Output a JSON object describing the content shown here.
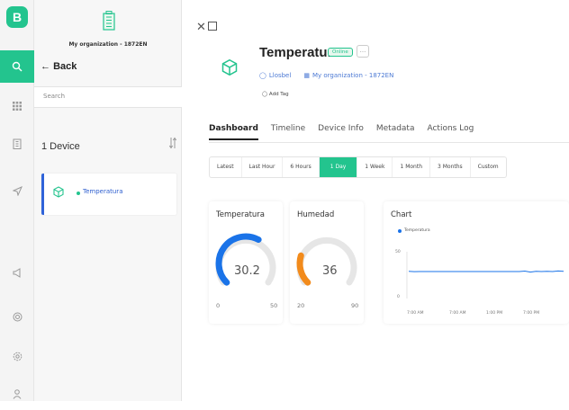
{
  "rail": {
    "logo_letter": "B",
    "icons": [
      "search-icon",
      "grid-icon",
      "building-icon",
      "send-icon",
      "megaphone-icon",
      "globe-icon",
      "settings-icon",
      "user-icon"
    ]
  },
  "panel": {
    "org_name": "My organization - 1872EN",
    "back_label": "Back",
    "search_placeholder": "Search",
    "device_count": "1 Device",
    "devices": [
      {
        "name": "Temperatura",
        "status": "online"
      }
    ]
  },
  "device": {
    "title": "Temperatura",
    "status_badge": "Online",
    "more_label": "...",
    "owner": "Llosbel",
    "organization": "My organization - 1872EN",
    "add_tag": "Add Tag"
  },
  "tabs": [
    {
      "label": "Dashboard",
      "active": true
    },
    {
      "label": "Timeline",
      "active": false
    },
    {
      "label": "Device Info",
      "active": false
    },
    {
      "label": "Metadata",
      "active": false
    },
    {
      "label": "Actions Log",
      "active": false
    }
  ],
  "time_ranges": [
    {
      "label": "Latest",
      "active": false
    },
    {
      "label": "Last Hour",
      "active": false
    },
    {
      "label": "6 Hours",
      "active": false
    },
    {
      "label": "1 Day",
      "active": true
    },
    {
      "label": "1 Week",
      "active": false
    },
    {
      "label": "1 Month",
      "active": false
    },
    {
      "label": "3 Months",
      "active": false
    },
    {
      "label": "Custom",
      "active": false
    }
  ],
  "gauges": [
    {
      "title": "Temperatura",
      "value": "30.2",
      "min": "0",
      "max": "50",
      "fraction": 0.604,
      "color": "#1a73e8"
    },
    {
      "title": "Humedad",
      "value": "36",
      "min": "20",
      "max": "90",
      "fraction": 0.229,
      "color": "#f28b1c"
    }
  ],
  "chart_widget": {
    "title": "Chart"
  },
  "chart_data": {
    "type": "line",
    "series": [
      {
        "name": "Temperatura",
        "color": "#1a73e8",
        "values": [
          30.2,
          29.9,
          30.0,
          30.0,
          30.0,
          30.0,
          30.0,
          30.0,
          30.0,
          30.0,
          30.0,
          30.0,
          30.0,
          30.0,
          30.0,
          30.0,
          30.0,
          30.0,
          30.0,
          30.0,
          30.0,
          30.5,
          29.4,
          30.3,
          30.0,
          30.2,
          30.0,
          30.6,
          30.2
        ]
      }
    ],
    "y_ticks": [
      "50",
      "0"
    ],
    "ylim": [
      0,
      50
    ],
    "x_ticks": [
      "7:00 AM",
      "7:00 AM",
      "1:00 PM",
      "7:00 PM"
    ],
    "grid": false,
    "legend": "top-left"
  }
}
